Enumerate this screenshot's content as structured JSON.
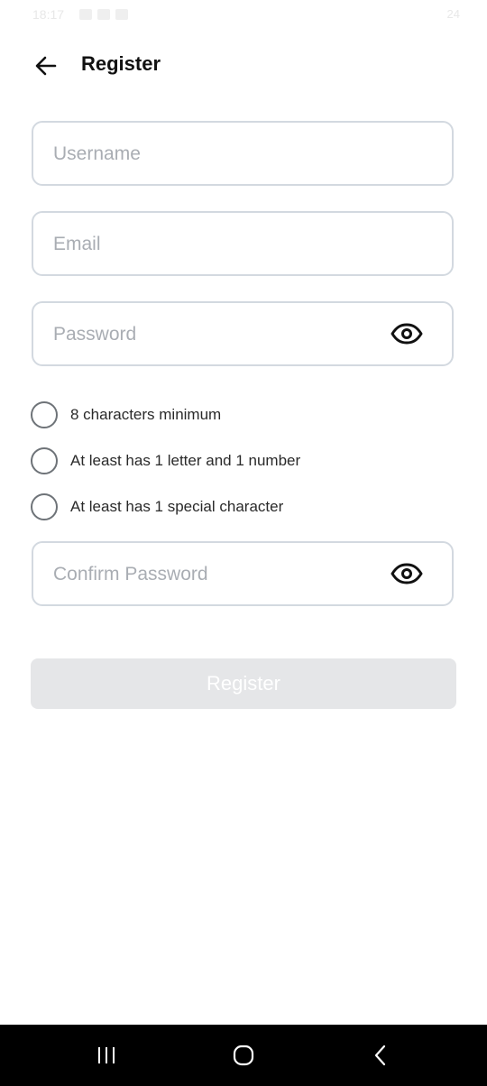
{
  "status_bar": {
    "time": "18:17",
    "right_text": "24"
  },
  "header": {
    "title": "Register"
  },
  "form": {
    "username": {
      "placeholder": "Username",
      "value": ""
    },
    "email": {
      "placeholder": "Email",
      "value": ""
    },
    "password": {
      "placeholder": "Password",
      "value": ""
    },
    "confirm_password": {
      "placeholder": "Confirm Password",
      "value": ""
    }
  },
  "password_rules": [
    {
      "label": "8 characters minimum",
      "met": false
    },
    {
      "label": "At least has 1 letter and 1 number",
      "met": false
    },
    {
      "label": "At least has 1 special character",
      "met": false
    }
  ],
  "submit": {
    "label": "Register",
    "enabled": false
  },
  "nav": {
    "icons": [
      "recent-apps-icon",
      "home-icon",
      "back-nav-icon"
    ]
  },
  "colors": {
    "field_border": "#d3d9e0",
    "button_disabled_bg": "#e5e6e8",
    "placeholder": "#a9adb3",
    "text": "#111111"
  }
}
